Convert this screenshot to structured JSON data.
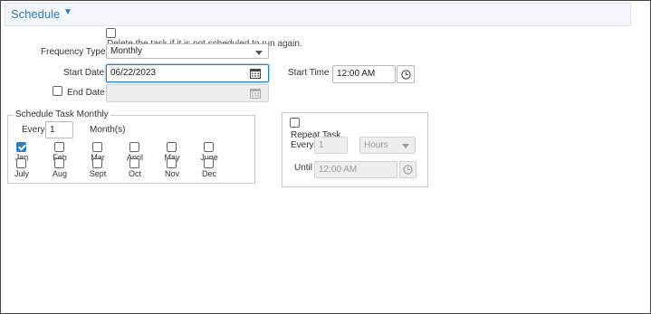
{
  "section": {
    "title": "Schedule"
  },
  "delete_task": {
    "label": "Delete the task if it is not scheduled to run again."
  },
  "frequency": {
    "label": "Frequency Type",
    "value": "Monthly"
  },
  "start_date": {
    "label": "Start Date",
    "value": "06/22/2023"
  },
  "start_time": {
    "label": "Start Time",
    "value": "12:00 AM"
  },
  "end_date": {
    "label": "End Date",
    "value": ""
  },
  "monthly": {
    "legend": "Schedule Task Monthly",
    "every_label": "Every",
    "every_value": "1",
    "unit_label": "Month(s)",
    "months": [
      {
        "label": "Jan",
        "checked": true
      },
      {
        "label": "Feb",
        "checked": false
      },
      {
        "label": "Mar",
        "checked": false
      },
      {
        "label": "April",
        "checked": false
      },
      {
        "label": "May",
        "checked": false
      },
      {
        "label": "June",
        "checked": false
      },
      {
        "label": "July",
        "checked": false
      },
      {
        "label": "Aug",
        "checked": false
      },
      {
        "label": "Sept",
        "checked": false
      },
      {
        "label": "Oct",
        "checked": false
      },
      {
        "label": "Nov",
        "checked": false
      },
      {
        "label": "Dec",
        "checked": false
      }
    ]
  },
  "repeat": {
    "label": "Repeat Task",
    "every_label": "Every",
    "every_value": "1",
    "unit_value": "Hours",
    "until_label": "Until",
    "until_value": "12:00 AM"
  },
  "colors": {
    "accent": "#2a7fc2"
  },
  "icons": {
    "header_caret": "caret-down-icon",
    "calendar": "calendar-icon",
    "clock": "clock-icon"
  }
}
